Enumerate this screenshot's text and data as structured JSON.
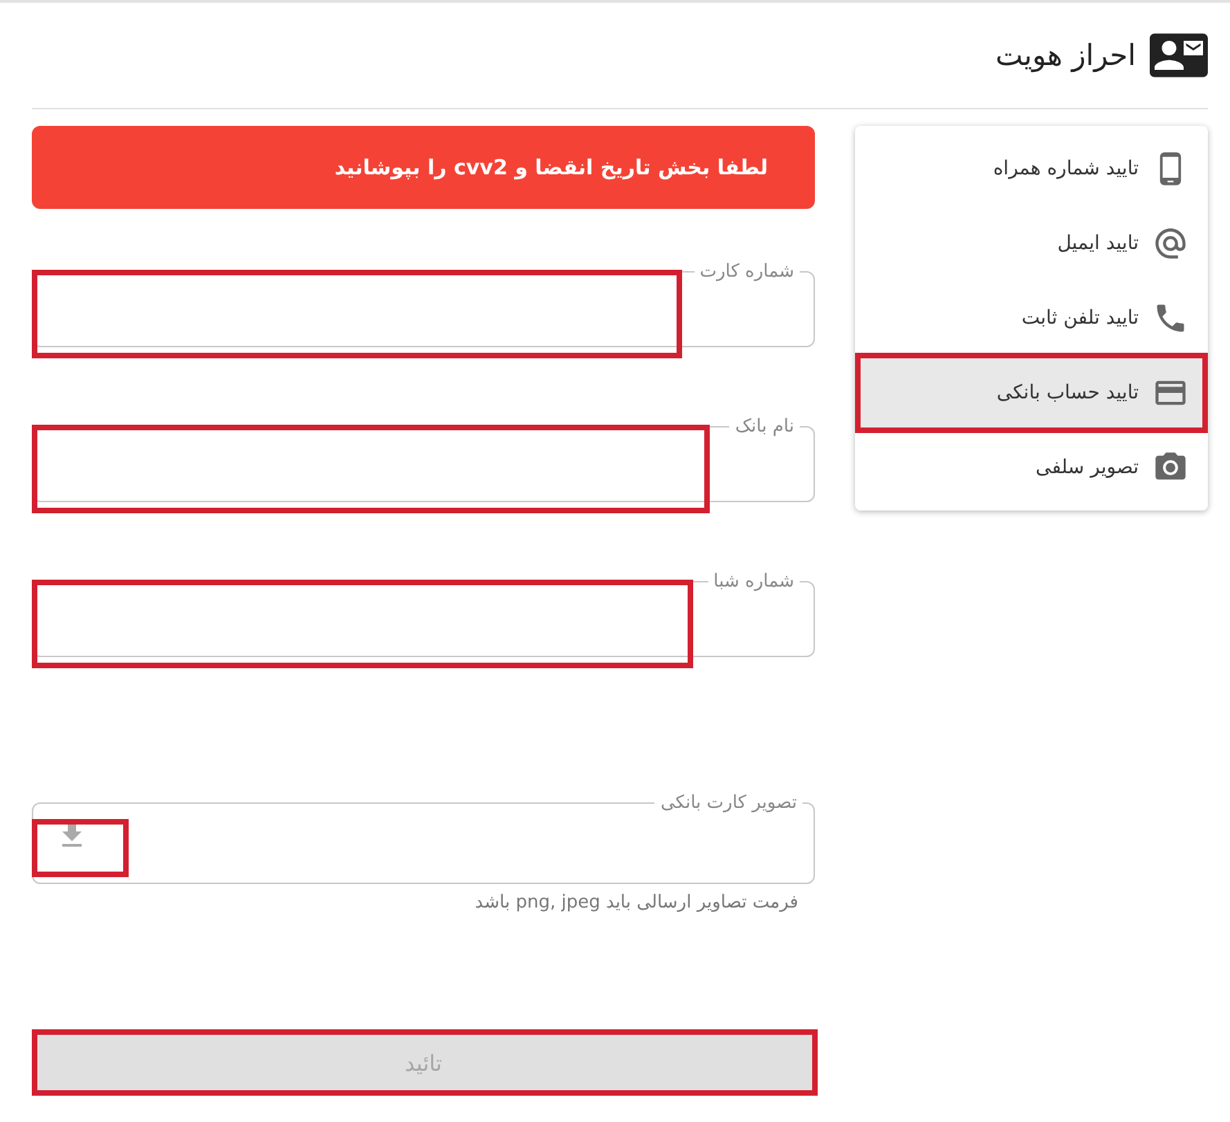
{
  "header": {
    "title": "احراز هویت"
  },
  "menu": [
    {
      "label": "تایید شماره همراه",
      "kind": "mobile",
      "selected": false,
      "highlighted": false
    },
    {
      "label": "تایید ایمیل",
      "kind": "email",
      "selected": false,
      "highlighted": false
    },
    {
      "label": "تایید تلفن ثابت",
      "kind": "phone",
      "selected": false,
      "highlighted": false
    },
    {
      "label": "تایید حساب بانکی",
      "kind": "card",
      "selected": true,
      "highlighted": true
    },
    {
      "label": "تصویر سلفی",
      "kind": "camera",
      "selected": false,
      "highlighted": false
    }
  ],
  "alert": "لطفا بخش تاریخ انقضا و cvv2 را بپوشانید",
  "fields": [
    {
      "label": "شماره کارت",
      "highlighted": true
    },
    {
      "label": "نام بانک",
      "highlighted": true
    },
    {
      "label": "شماره شبا",
      "highlighted": true
    }
  ],
  "upload": {
    "label": "تصویر کارت بانکی",
    "hint": "فرمت تصاویر ارسالی باید png, jpeg باشد",
    "highlighted": true
  },
  "submit": {
    "label": "تائید",
    "disabled": true,
    "highlighted": true
  }
}
